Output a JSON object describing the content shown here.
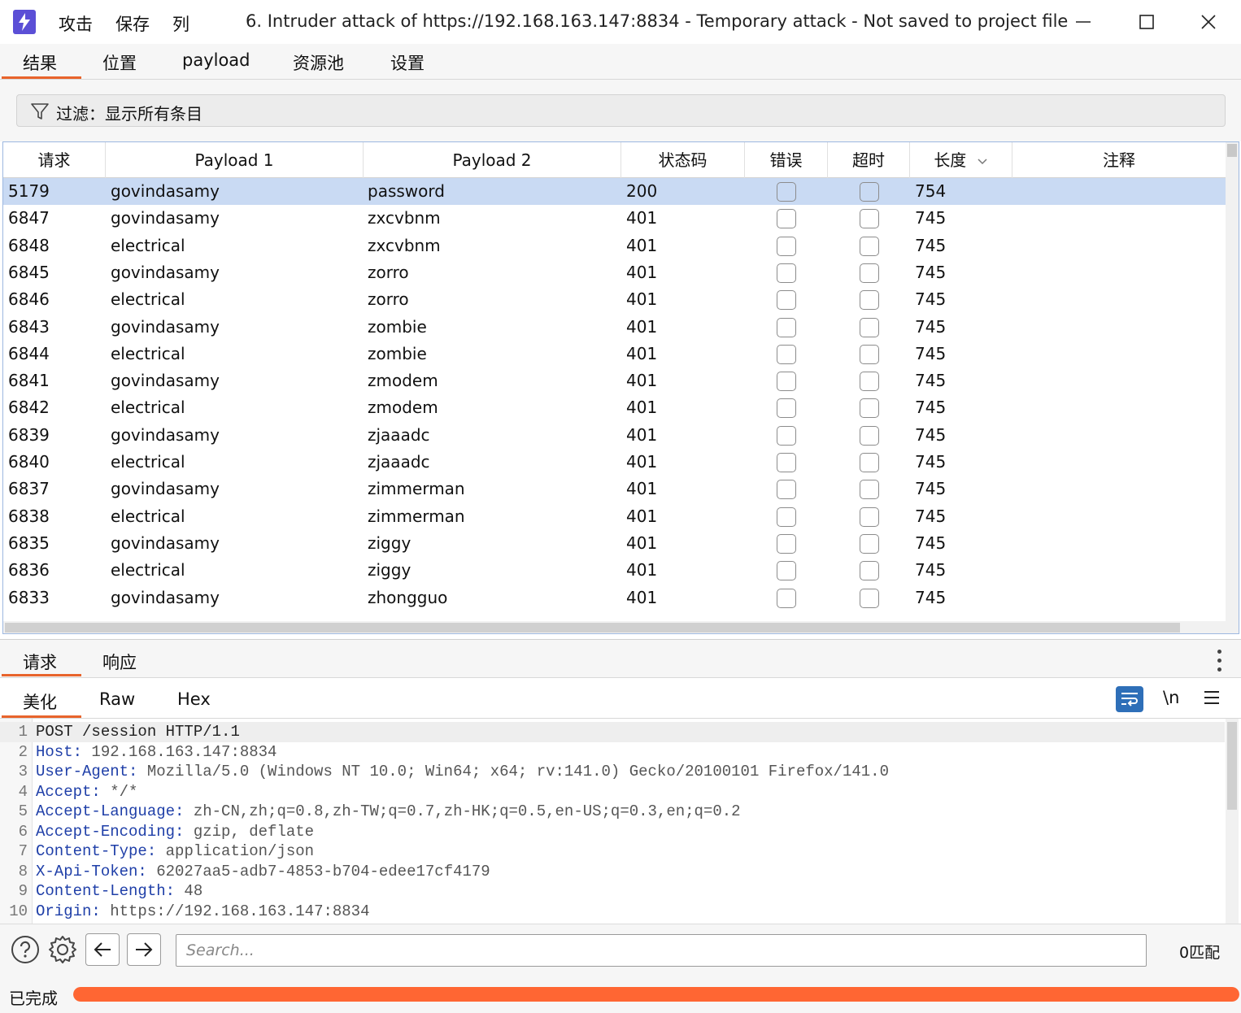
{
  "titlebar": {
    "menu": [
      "攻击",
      "保存",
      "列"
    ],
    "title": "6. Intruder attack of https://192.168.163.147:8834 - Temporary attack - Not saved to project file"
  },
  "main_tabs": [
    "结果",
    "位置",
    "payload",
    "资源池",
    "设置"
  ],
  "filter": {
    "label": "过滤：显示所有条目"
  },
  "table": {
    "columns": [
      "请求",
      "Payload 1",
      "Payload 2",
      "状态码",
      "错误",
      "超时",
      "长度",
      "注释"
    ],
    "sort_column": "长度",
    "rows": [
      {
        "req": "5179",
        "p1": "govindasamy",
        "p2": "password",
        "status": "200",
        "len": "754",
        "selected": true
      },
      {
        "req": "6847",
        "p1": "govindasamy",
        "p2": "zxcvbnm",
        "status": "401",
        "len": "745"
      },
      {
        "req": "6848",
        "p1": "electrical",
        "p2": "zxcvbnm",
        "status": "401",
        "len": "745"
      },
      {
        "req": "6845",
        "p1": "govindasamy",
        "p2": "zorro",
        "status": "401",
        "len": "745"
      },
      {
        "req": "6846",
        "p1": "electrical",
        "p2": "zorro",
        "status": "401",
        "len": "745"
      },
      {
        "req": "6843",
        "p1": "govindasamy",
        "p2": "zombie",
        "status": "401",
        "len": "745"
      },
      {
        "req": "6844",
        "p1": "electrical",
        "p2": "zombie",
        "status": "401",
        "len": "745"
      },
      {
        "req": "6841",
        "p1": "govindasamy",
        "p2": "zmodem",
        "status": "401",
        "len": "745"
      },
      {
        "req": "6842",
        "p1": "electrical",
        "p2": "zmodem",
        "status": "401",
        "len": "745"
      },
      {
        "req": "6839",
        "p1": "govindasamy",
        "p2": "zjaaadc",
        "status": "401",
        "len": "745"
      },
      {
        "req": "6840",
        "p1": "electrical",
        "p2": "zjaaadc",
        "status": "401",
        "len": "745"
      },
      {
        "req": "6837",
        "p1": "govindasamy",
        "p2": "zimmerman",
        "status": "401",
        "len": "745"
      },
      {
        "req": "6838",
        "p1": "electrical",
        "p2": "zimmerman",
        "status": "401",
        "len": "745"
      },
      {
        "req": "6835",
        "p1": "govindasamy",
        "p2": "ziggy",
        "status": "401",
        "len": "745"
      },
      {
        "req": "6836",
        "p1": "electrical",
        "p2": "ziggy",
        "status": "401",
        "len": "745"
      },
      {
        "req": "6833",
        "p1": "govindasamy",
        "p2": "zhongguo",
        "status": "401",
        "len": "745"
      }
    ]
  },
  "lower_tabs": [
    "请求",
    "响应"
  ],
  "view_tabs": [
    "美化",
    "Raw",
    "Hex"
  ],
  "editor_tools": {
    "newline": "\\n"
  },
  "request_lines": [
    {
      "n": "1",
      "key": "",
      "value": "POST /session HTTP/1.1"
    },
    {
      "n": "2",
      "key": "Host:",
      "value": " 192.168.163.147:8834"
    },
    {
      "n": "3",
      "key": "User-Agent:",
      "value": " Mozilla/5.0 (Windows NT 10.0; Win64; x64; rv:141.0) Gecko/20100101 Firefox/141.0"
    },
    {
      "n": "4",
      "key": "Accept:",
      "value": " */*"
    },
    {
      "n": "5",
      "key": "Accept-Language:",
      "value": " zh-CN,zh;q=0.8,zh-TW;q=0.7,zh-HK;q=0.5,en-US;q=0.3,en;q=0.2"
    },
    {
      "n": "6",
      "key": "Accept-Encoding:",
      "value": " gzip, deflate"
    },
    {
      "n": "7",
      "key": "Content-Type:",
      "value": " application/json"
    },
    {
      "n": "8",
      "key": "X-Api-Token:",
      "value": " 62027aa5-adb7-4853-b704-edee17cf4179"
    },
    {
      "n": "9",
      "key": "Content-Length:",
      "value": " 48"
    },
    {
      "n": "10",
      "key": "Origin:",
      "value": " https://192.168.163.147:8834"
    }
  ],
  "search": {
    "placeholder": "Search...",
    "matches": "0匹配"
  },
  "status": {
    "text": "已完成",
    "progress": 1.0,
    "progress_color": "#ff6633"
  },
  "colors": {
    "accent": "#e8642c",
    "selected_row": "#c9daf3",
    "header_key": "#1f3fa8"
  }
}
